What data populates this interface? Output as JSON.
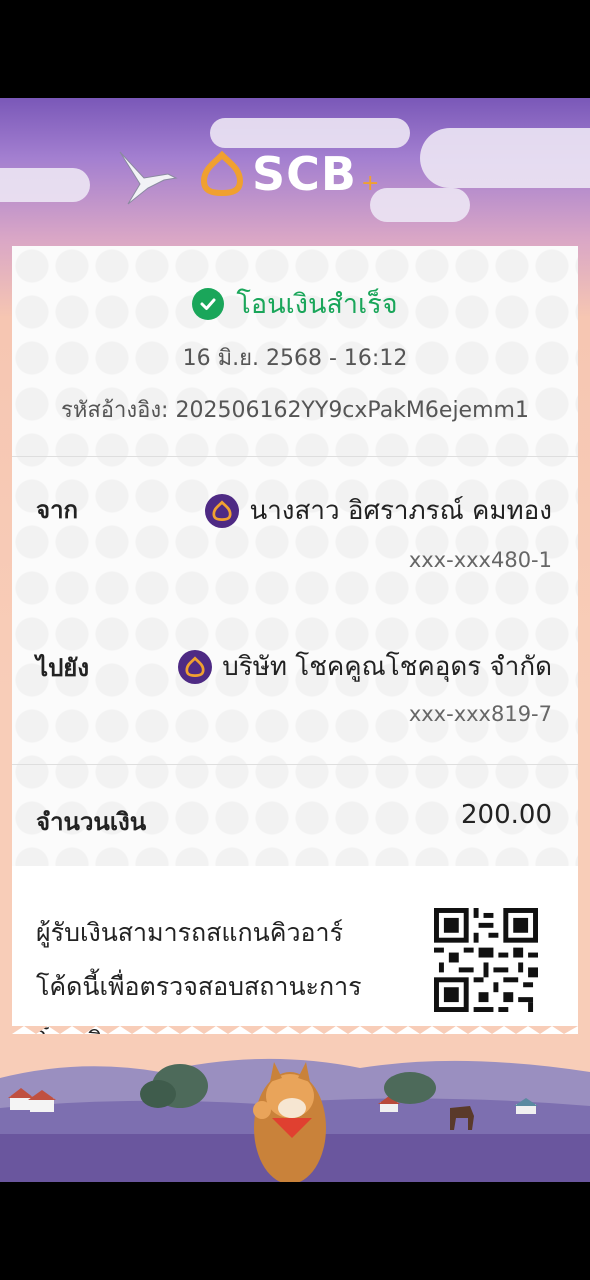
{
  "brand": {
    "name": "SCB",
    "plus_glyph": "+"
  },
  "status": {
    "text": "โอนเงินสำเร็จ",
    "icon": "check-circle-icon",
    "color": "#1aa65a"
  },
  "transaction": {
    "datetime": "16 มิ.ย. 2568 - 16:12",
    "reference": "รหัสอ้างอิง: 202506162YY9cxPakM6ejemm1"
  },
  "from": {
    "label": "จาก",
    "name": "นางสาว อิศราภรณ์ คมทอง",
    "account": "xxx-xxx480-1"
  },
  "to": {
    "label": "ไปยัง",
    "name": "บริษัท โชคคูณโชคอุดร จำกัด",
    "account": "xxx-xxx819-7"
  },
  "amount": {
    "label": "จำนวนเงิน",
    "value": "200.00"
  },
  "qr_note": {
    "line1": "ผู้รับเงินสามารถสแกนคิวอาร์",
    "line2": "โค้ดนี้เพื่อตรวจสอบสถานะการ",
    "line3": "โอนเงิน"
  },
  "colors": {
    "brand_purple": "#4e2a84",
    "brand_gold": "#f0a030",
    "success_green": "#1aa65a"
  }
}
